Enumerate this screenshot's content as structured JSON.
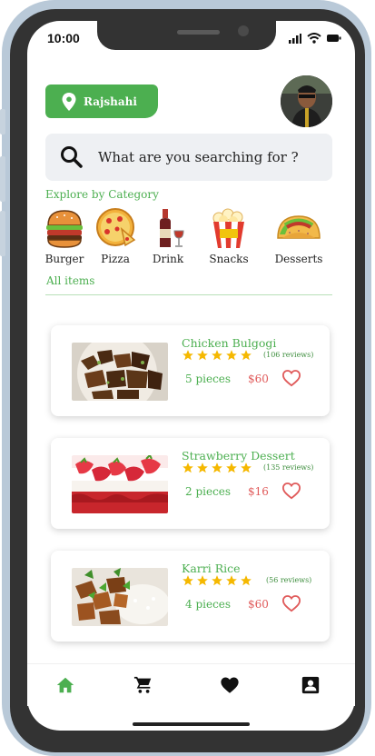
{
  "status": {
    "time": "10:00"
  },
  "location": {
    "label": "Rajshahi"
  },
  "search": {
    "placeholder": "What are you searching for ?"
  },
  "explore_title": "Explore by Category",
  "categories": [
    {
      "label": "Burger"
    },
    {
      "label": "Pizza"
    },
    {
      "label": "Drink"
    },
    {
      "label": "Snacks"
    },
    {
      "label": "Desserts"
    }
  ],
  "all_items_title": "All items",
  "items": [
    {
      "name": "Chicken Bulgogi",
      "rating": 5,
      "reviews": "(106 reviews)",
      "pieces": "5 pieces",
      "price": "$60"
    },
    {
      "name": "Strawberry Dessert",
      "rating": 5,
      "reviews": "(135 reviews)",
      "pieces": "2 pieces",
      "price": "$16"
    },
    {
      "name": "Karri Rice",
      "rating": 5,
      "reviews": "(56 reviews)",
      "pieces": "4 pieces",
      "price": "$60"
    }
  ],
  "colors": {
    "accent": "#4caf50",
    "price": "#e05a5a",
    "star": "#f5b800",
    "heart": "#e05a5a"
  },
  "nav": [
    {
      "icon": "home-icon",
      "active": true
    },
    {
      "icon": "cart-icon",
      "active": false
    },
    {
      "icon": "heart-icon",
      "active": false
    },
    {
      "icon": "profile-icon",
      "active": false
    }
  ]
}
